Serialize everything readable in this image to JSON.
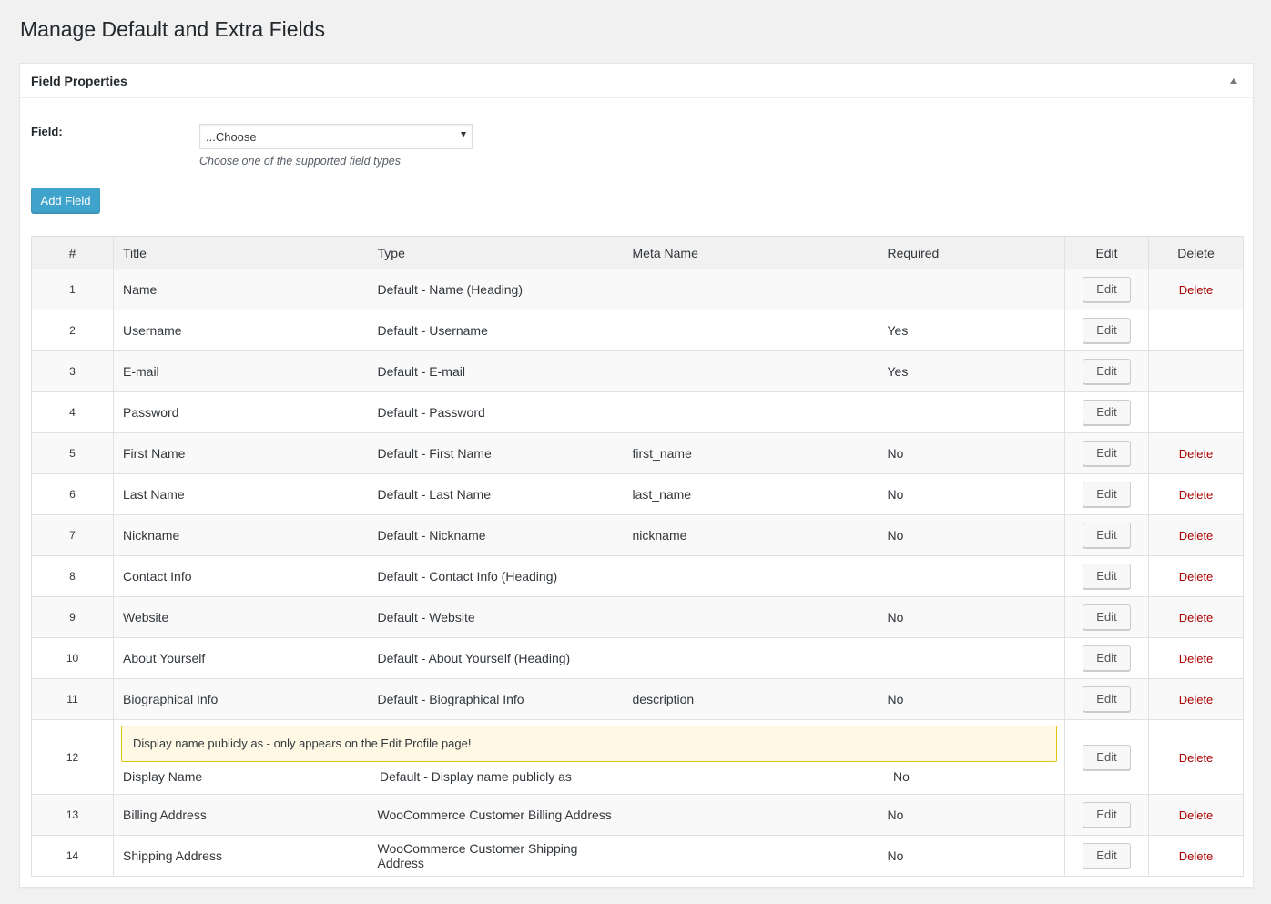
{
  "page": {
    "title": "Manage Default and Extra Fields"
  },
  "panel": {
    "title": "Field Properties",
    "field_label": "Field:",
    "select_value": "...Choose",
    "select_description": "Choose one of the supported field types",
    "add_button": "Add Field"
  },
  "table": {
    "headers": {
      "num": "#",
      "title": "Title",
      "type": "Type",
      "meta": "Meta Name",
      "required": "Required",
      "edit": "Edit",
      "delete": "Delete"
    },
    "edit_label": "Edit",
    "delete_label": "Delete",
    "notice": "Display name publicly as - only appears on the Edit Profile page!",
    "rows": [
      {
        "num": "1",
        "title": "Name",
        "type": "Default - Name (Heading)",
        "meta": "",
        "required": "",
        "deletable": true
      },
      {
        "num": "2",
        "title": "Username",
        "type": "Default - Username",
        "meta": "",
        "required": "Yes",
        "deletable": false
      },
      {
        "num": "3",
        "title": "E-mail",
        "type": "Default - E-mail",
        "meta": "",
        "required": "Yes",
        "deletable": false
      },
      {
        "num": "4",
        "title": "Password",
        "type": "Default - Password",
        "meta": "",
        "required": "",
        "deletable": false
      },
      {
        "num": "5",
        "title": "First Name",
        "type": "Default - First Name",
        "meta": "first_name",
        "required": "No",
        "deletable": true
      },
      {
        "num": "6",
        "title": "Last Name",
        "type": "Default - Last Name",
        "meta": "last_name",
        "required": "No",
        "deletable": true
      },
      {
        "num": "7",
        "title": "Nickname",
        "type": "Default - Nickname",
        "meta": "nickname",
        "required": "No",
        "deletable": true
      },
      {
        "num": "8",
        "title": "Contact Info",
        "type": "Default - Contact Info (Heading)",
        "meta": "",
        "required": "",
        "deletable": true
      },
      {
        "num": "9",
        "title": "Website",
        "type": "Default - Website",
        "meta": "",
        "required": "No",
        "deletable": true
      },
      {
        "num": "10",
        "title": "About Yourself",
        "type": "Default - About Yourself (Heading)",
        "meta": "",
        "required": "",
        "deletable": true
      },
      {
        "num": "11",
        "title": "Biographical Info",
        "type": "Default - Biographical Info",
        "meta": "description",
        "required": "No",
        "deletable": true
      },
      {
        "num": "12",
        "title": "Display Name",
        "type": "Default - Display name publicly as",
        "meta": "",
        "required": "No",
        "deletable": true,
        "notice": true
      },
      {
        "num": "13",
        "title": "Billing Address",
        "type": "WooCommerce Customer Billing Address",
        "meta": "",
        "required": "No",
        "deletable": true
      },
      {
        "num": "14",
        "title": "Shipping Address",
        "type": "WooCommerce Customer Shipping Address",
        "meta": "",
        "required": "No",
        "deletable": true
      }
    ]
  },
  "colors": {
    "primary_button": "#0085ba",
    "delete_link": "#a00",
    "notice_border": "#e6c40e"
  }
}
